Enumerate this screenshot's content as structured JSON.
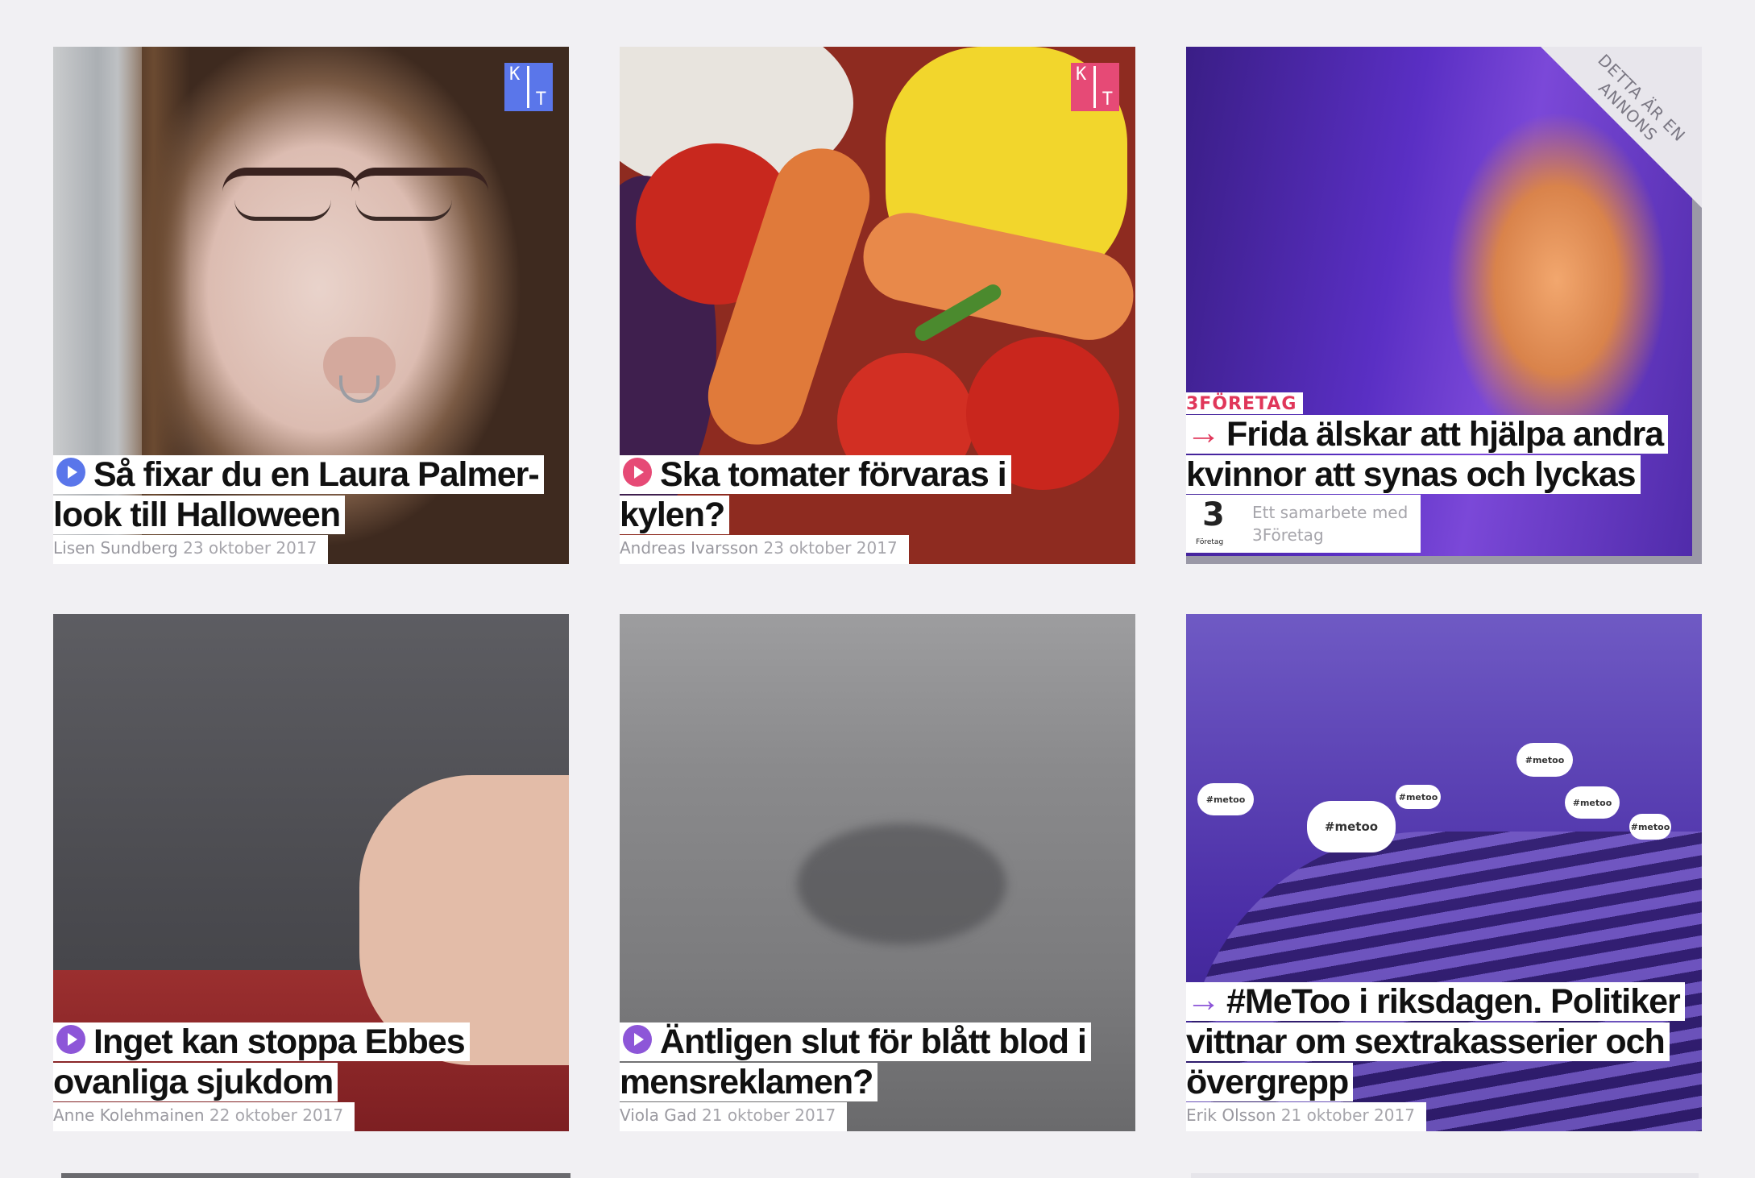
{
  "colors": {
    "background": "#f1f0f3",
    "play_blue": "#5a76ea",
    "play_pink": "#e64a76",
    "play_purple": "#8d56d8",
    "arrow_red": "#e0375a",
    "arrow_purple": "#8d56d8",
    "kt_blue": "#5a76ea",
    "kt_pink": "#e64a76"
  },
  "articles": [
    {
      "title": "Så fixar du en Laura Palmer-look till Halloween",
      "author": "Lisen Sundberg",
      "date": "23 oktober 2017",
      "icon": "play-icon",
      "badge": "kt-logo",
      "badge_letters": [
        "K",
        "T"
      ]
    },
    {
      "title": "Ska tomater förvaras i kylen?",
      "author": "Andreas Ivarsson",
      "date": "23 oktober 2017",
      "icon": "play-icon",
      "badge": "kt-logo",
      "badge_letters": [
        "K",
        "T"
      ]
    },
    {
      "sponsor_tag": "3FÖRETAG",
      "title": "Frida älskar att hjälpa andra kvinnor att synas och lyckas",
      "sponsor_line1": "Ett samarbete med",
      "sponsor_line2": "3Företag",
      "sponsor_logo_glyph": "3",
      "sponsor_logo_label": "Företag",
      "corner_label": "DETTA ÄR EN ANNONS",
      "icon": "arrow-right-icon"
    },
    {
      "title": "Inget kan stoppa Ebbes ovanliga sjukdom",
      "author": "Anne Kolehmainen",
      "date": "22 oktober 2017",
      "icon": "play-icon"
    },
    {
      "title": "Äntligen slut för blått blod i mensreklamen?",
      "author": "Viola Gad",
      "date": "21 oktober 2017",
      "icon": "play-icon"
    },
    {
      "title": "#MeToo i riksdagen. Politiker vittnar om sextrakasserier och övergrepp",
      "author": "Erik Olsson",
      "date": "21 oktober 2017",
      "icon": "arrow-right-icon",
      "bubbles": [
        "#metoo",
        "#metoo",
        "#metoo",
        "#metoo",
        "#metoo",
        "#metoo"
      ]
    }
  ]
}
